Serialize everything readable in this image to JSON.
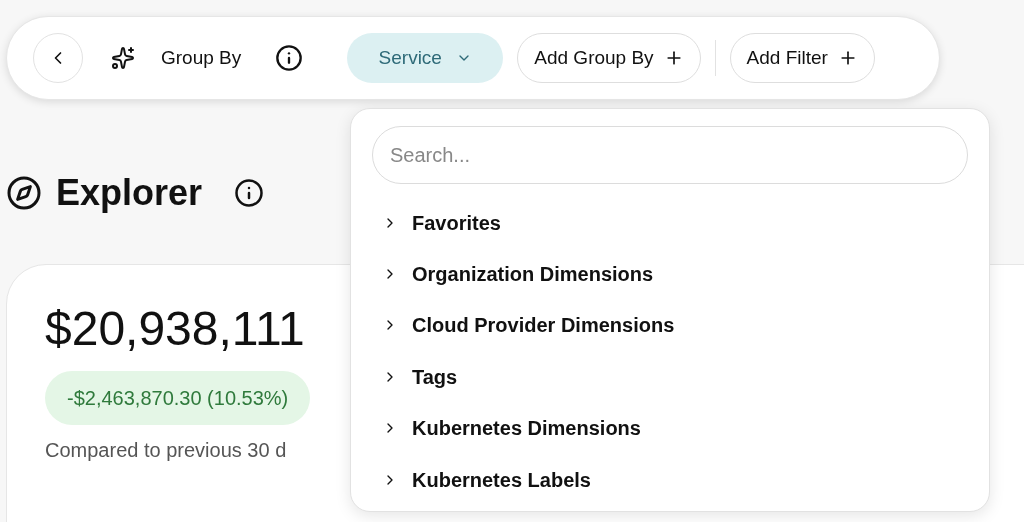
{
  "toolbar": {
    "group_by_label": "Group By",
    "group_by_chip": {
      "label": "Service",
      "expanded": true
    },
    "add_group_by": "Add Group By",
    "add_filter": "Add Filter"
  },
  "page": {
    "title": "Explorer"
  },
  "summary": {
    "total": "$20,938,111",
    "change": "-$2,463,870.30 (10.53%)",
    "decreased": true,
    "comparison": "Compared to previous 30 d"
  },
  "dropdown": {
    "search": {
      "placeholder": "Search..."
    },
    "items": [
      {
        "label": "Favorites",
        "expanded": false
      },
      {
        "label": "Organization Dimensions",
        "expanded": false
      },
      {
        "label": "Cloud Provider Dimensions",
        "expanded": false
      },
      {
        "label": "Tags",
        "expanded": false
      },
      {
        "label": "Kubernetes Dimensions",
        "expanded": false
      },
      {
        "label": "Kubernetes Labels",
        "expanded": false
      }
    ]
  }
}
